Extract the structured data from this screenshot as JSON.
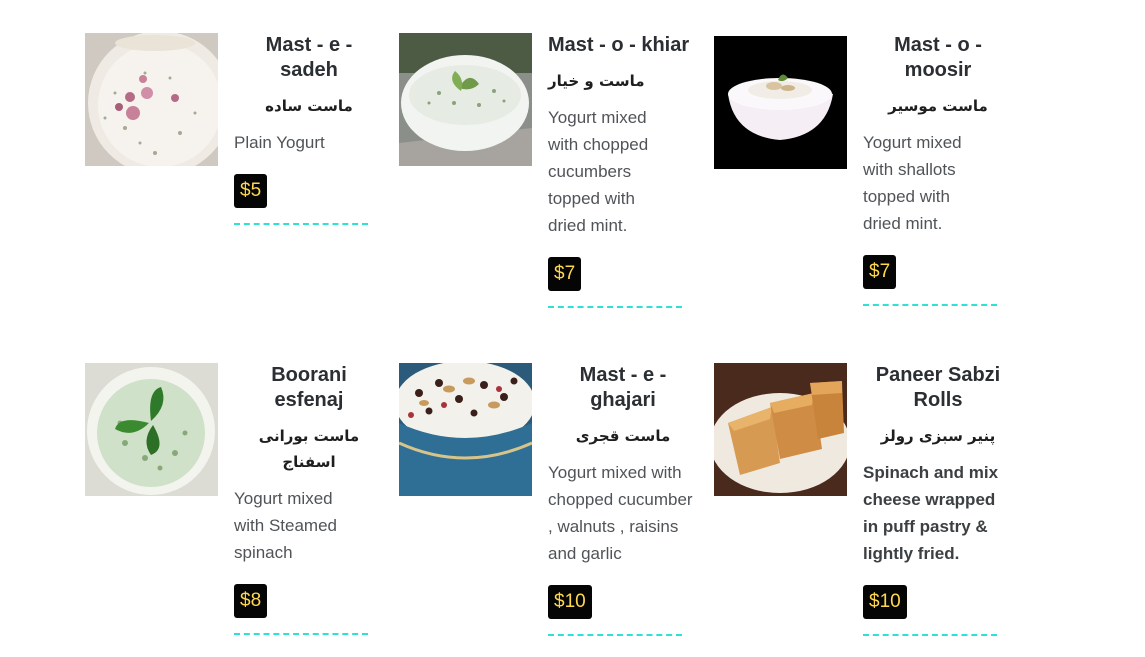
{
  "menu": {
    "items": [
      {
        "title": "Mast - e - sadeh",
        "farsi": "ماست ساده",
        "description": "Plain Yogurt",
        "price": "$5",
        "image": "bowl of plain yogurt topped with rose petals and herbs"
      },
      {
        "title": "Mast - o - khiar",
        "farsi": "ماست و خیار",
        "description": "Yogurt mixed with chopped cucumbers topped with dried mint.",
        "price": "$7",
        "image": "white bowl of yogurt with cucumber and mint"
      },
      {
        "title": "Mast - o - moosir",
        "farsi": "ماست موسیر",
        "description": "Yogurt mixed with shallots topped with dried mint.",
        "price": "$7",
        "image": "white bowl of shallot yogurt on black background"
      },
      {
        "title": "Boorani esfenaj",
        "farsi": "ماست بورانی اسفناج",
        "description": "Yogurt mixed with Steamed spinach",
        "price": "$8",
        "image": "bowl of spinach yogurt with basil leaves"
      },
      {
        "title": "Mast - e - ghajari",
        "farsi": "ماست قجری",
        "description": "Yogurt mixed with chopped cucumber , walnuts , raisins and garlic",
        "price": "$10",
        "image": "blue bowl of yogurt topped with nuts and raisins"
      },
      {
        "title": "Paneer Sabzi Rolls",
        "farsi": "پنیر سبزی رولز",
        "description": "Spinach and mix cheese wrapped in puff pastry & lightly fried.",
        "price": "$10",
        "image": "golden puff pastry rolls on a plate"
      }
    ]
  },
  "colors": {
    "price_bg": "#050505",
    "price_text": "#ffd84d",
    "divider": "#2fe0d4"
  }
}
